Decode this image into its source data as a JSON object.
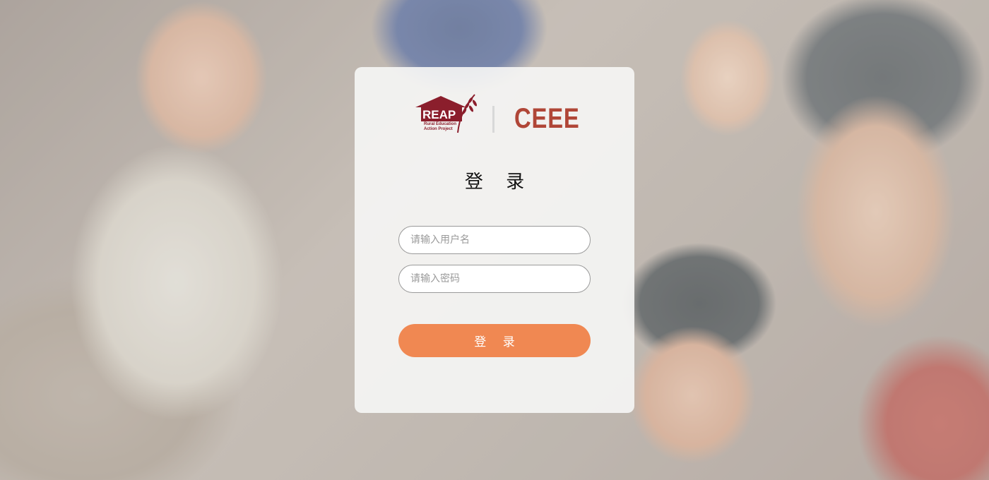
{
  "brand": {
    "reap_logo_alt": "REAP Rural Education Action Project",
    "reap_name": "REAP",
    "reap_tagline_line1": "Rural Education",
    "reap_tagline_line2": "Action Project",
    "partner_name": "CEEE",
    "accent_color": "#b04637"
  },
  "login": {
    "title": "登 录",
    "username_placeholder": "请输入用户名",
    "password_placeholder": "请输入密码",
    "username_value": "",
    "password_value": "",
    "submit_label": "登 录",
    "button_color": "#f08852"
  }
}
